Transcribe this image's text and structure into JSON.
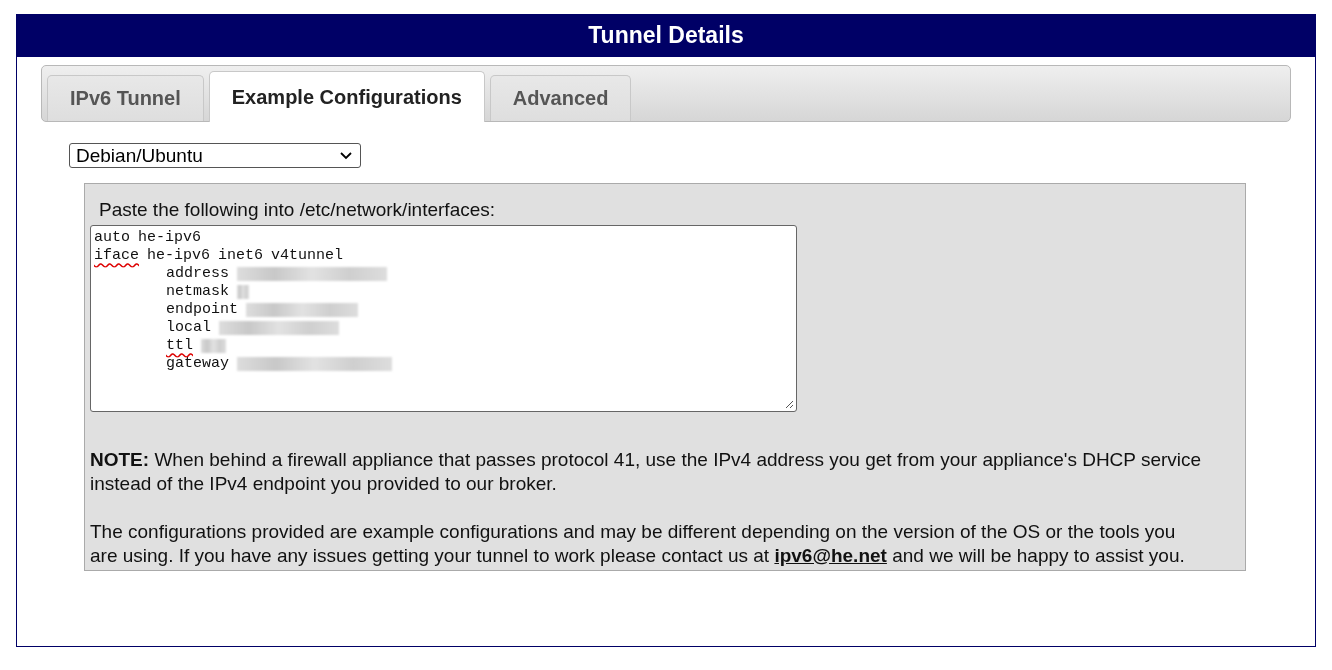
{
  "header": {
    "title": "Tunnel Details"
  },
  "tabs": [
    {
      "label": "IPv6 Tunnel",
      "selected": false
    },
    {
      "label": "Example Configurations",
      "selected": true
    },
    {
      "label": "Advanced",
      "selected": false
    }
  ],
  "os_select": {
    "value": "Debian/Ubuntu"
  },
  "config": {
    "instruction": "Paste the following into /etc/network/interfaces:",
    "lines": [
      {
        "indented": false,
        "redacted": false,
        "words": [
          {
            "text": "auto",
            "misspelled": false
          },
          {
            "text": "he-ipv6",
            "misspelled": false
          }
        ]
      },
      {
        "indented": false,
        "redacted": false,
        "words": [
          {
            "text": "iface",
            "misspelled": true
          },
          {
            "text": "he-ipv6",
            "misspelled": false
          },
          {
            "text": "inet6",
            "misspelled": false
          },
          {
            "text": "v4tunnel",
            "misspelled": false
          }
        ]
      },
      {
        "indented": true,
        "redacted": true,
        "words": [
          {
            "text": "address",
            "misspelled": false
          }
        ]
      },
      {
        "indented": true,
        "redacted": true,
        "words": [
          {
            "text": "netmask",
            "misspelled": false
          }
        ]
      },
      {
        "indented": true,
        "redacted": true,
        "words": [
          {
            "text": "endpoint",
            "misspelled": false
          }
        ]
      },
      {
        "indented": true,
        "redacted": true,
        "words": [
          {
            "text": "local",
            "misspelled": false
          }
        ]
      },
      {
        "indented": true,
        "redacted": true,
        "words": [
          {
            "text": "ttl",
            "misspelled": true
          }
        ]
      },
      {
        "indented": true,
        "redacted": true,
        "words": [
          {
            "text": "gateway",
            "misspelled": false
          }
        ]
      }
    ]
  },
  "note": "**NOTE:** When behind a firewall appliance that passes protocol 41, use the IPv4 address you get from your appliance's DHCP service instead of the IPv4 endpoint you provided to our broker.",
  "disclaimer": {
    "before": "The configurations provided are example configurations and may be different depending on the version of the OS or the tools you are using. If you have any issues getting your tunnel to work please contact us at",
    "link": "ipv6@he.net",
    "after": "and we will be happy to assist you."
  }
}
